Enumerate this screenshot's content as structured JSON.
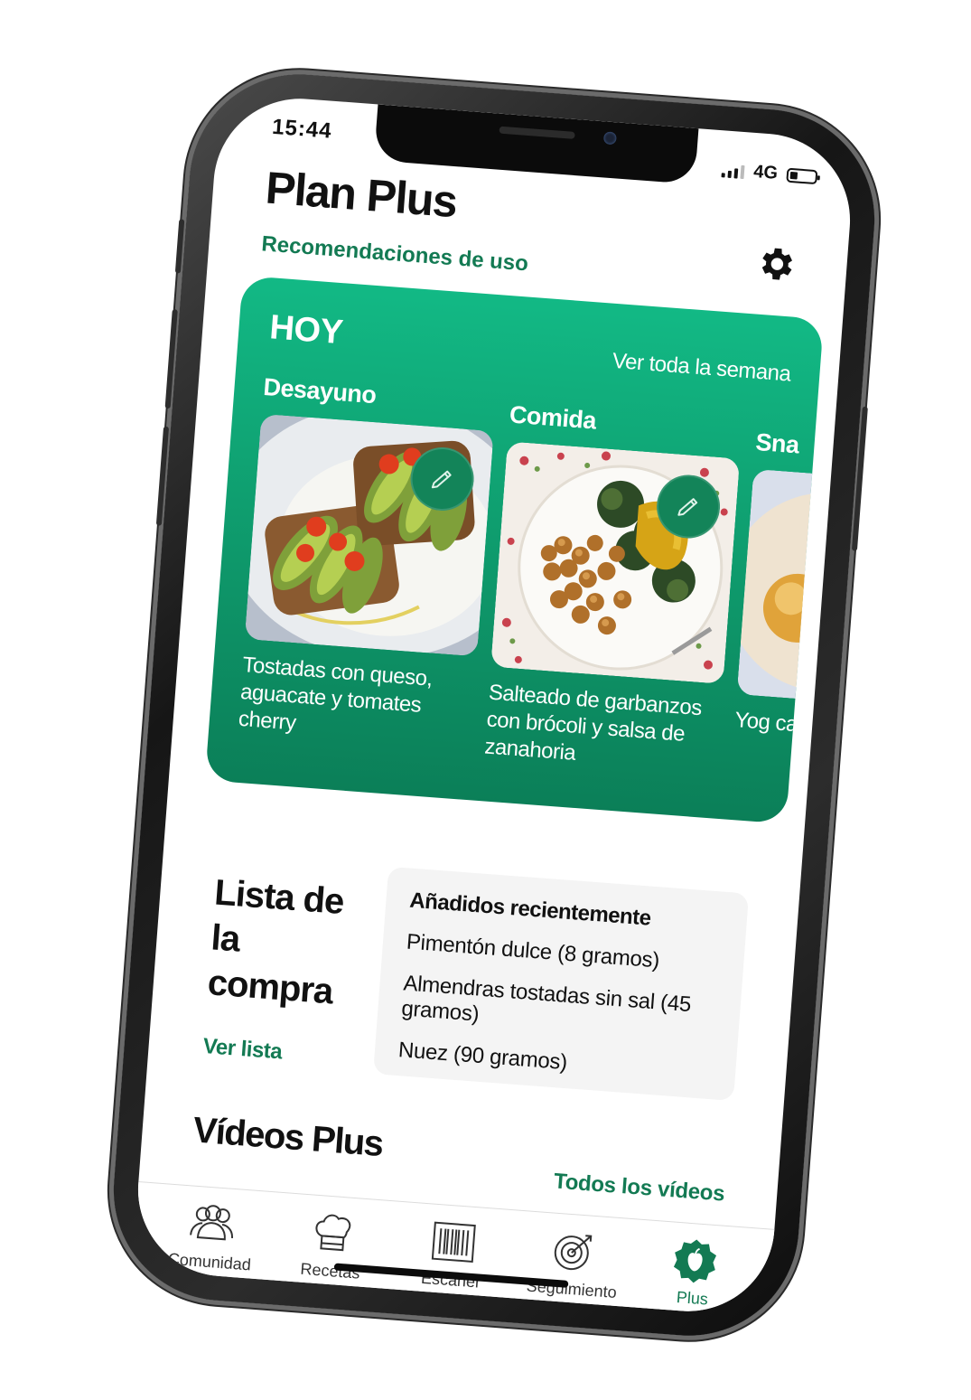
{
  "status_bar": {
    "time": "15:44",
    "network": "4G"
  },
  "header": {
    "title": "Plan Plus",
    "usage_link": "Recomendaciones de uso",
    "settings_icon": "gear-icon"
  },
  "today": {
    "label": "HOY",
    "week_link": "Ver toda la semana",
    "meals": [
      {
        "title": "Desayuno",
        "description": "Tostadas con queso, aguacate y tomates cherry"
      },
      {
        "title": "Comida",
        "description": "Salteado de garbanzos con brócoli y salsa de zanahoria"
      },
      {
        "title": "Sna",
        "description": "Yog caq"
      }
    ]
  },
  "shopping": {
    "title": "Lista de la compra",
    "link": "Ver lista",
    "recent_heading": "Añadidos recientemente",
    "items": [
      "Pimentón dulce (8 gramos)",
      "Almendras tostadas sin sal (45 gramos)",
      "Nuez (90 gramos)"
    ]
  },
  "videos": {
    "title": "Vídeos Plus",
    "link": "Todos los vídeos"
  },
  "tabbar": [
    {
      "label": "Comunidad",
      "icon": "community-icon"
    },
    {
      "label": "Recetas",
      "icon": "chef-hat-icon"
    },
    {
      "label": "Escáner",
      "icon": "barcode-icon"
    },
    {
      "label": "Seguimiento",
      "icon": "target-icon"
    },
    {
      "label": "Plus",
      "icon": "plus-apple-icon"
    }
  ],
  "colors": {
    "accent": "#137a53",
    "card_top": "#12b985",
    "card_bottom": "#0b7f58"
  }
}
